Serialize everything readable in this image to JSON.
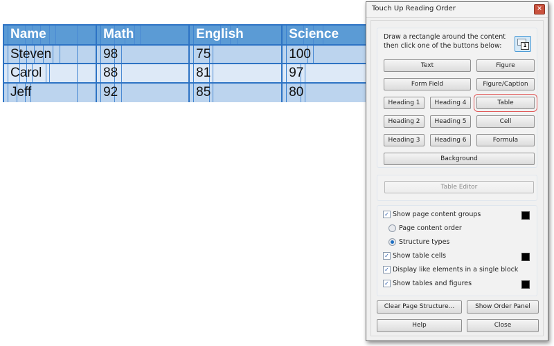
{
  "table": {
    "headers": [
      "Name",
      "Math",
      "English",
      "Science"
    ],
    "rows": [
      [
        "Steven",
        "98",
        "75",
        "100"
      ],
      [
        "Carol",
        "88",
        "81",
        "97"
      ],
      [
        "Jeff",
        "92",
        "85",
        "80"
      ]
    ],
    "colors": {
      "header": "#5b9bd5",
      "row_dark": "#bcd4ee",
      "row_light": "#dde9f7",
      "border": "#2d73c4"
    }
  },
  "dialog": {
    "title": "Touch Up Reading Order",
    "close_icon": "close-x",
    "instructions": "Draw a rectangle around the content then click one of the buttons below:",
    "instruction_icon": "reading-order-icon",
    "instruction_icon_label": "1",
    "buttons": {
      "text": "Text",
      "figure": "Figure",
      "form_field": "Form Field",
      "figure_caption": "Figure/Caption",
      "heading1": "Heading 1",
      "heading4": "Heading 4",
      "table": "Table",
      "heading2": "Heading 2",
      "heading5": "Heading 5",
      "cell": "Cell",
      "heading3": "Heading 3",
      "heading6": "Heading 6",
      "formula": "Formula",
      "background": "Background",
      "table_editor": "Table Editor",
      "clear_page_structure": "Clear Page Structure...",
      "show_order_panel": "Show Order Panel",
      "help": "Help",
      "close": "Close"
    },
    "options": {
      "show_page_content_groups": {
        "label": "Show page content groups",
        "checked": true,
        "color": "#000000"
      },
      "page_content_order": {
        "label": "Page content order",
        "selected": false
      },
      "structure_types": {
        "label": "Structure types",
        "selected": true
      },
      "show_table_cells": {
        "label": "Show table cells",
        "checked": true,
        "color": "#000000"
      },
      "display_like_elements": {
        "label": "Display like elements in a single block",
        "checked": true
      },
      "show_tables_figures": {
        "label": "Show tables and figures",
        "checked": true,
        "color": "#000000"
      }
    },
    "highlight_color": "#e15a5a"
  }
}
